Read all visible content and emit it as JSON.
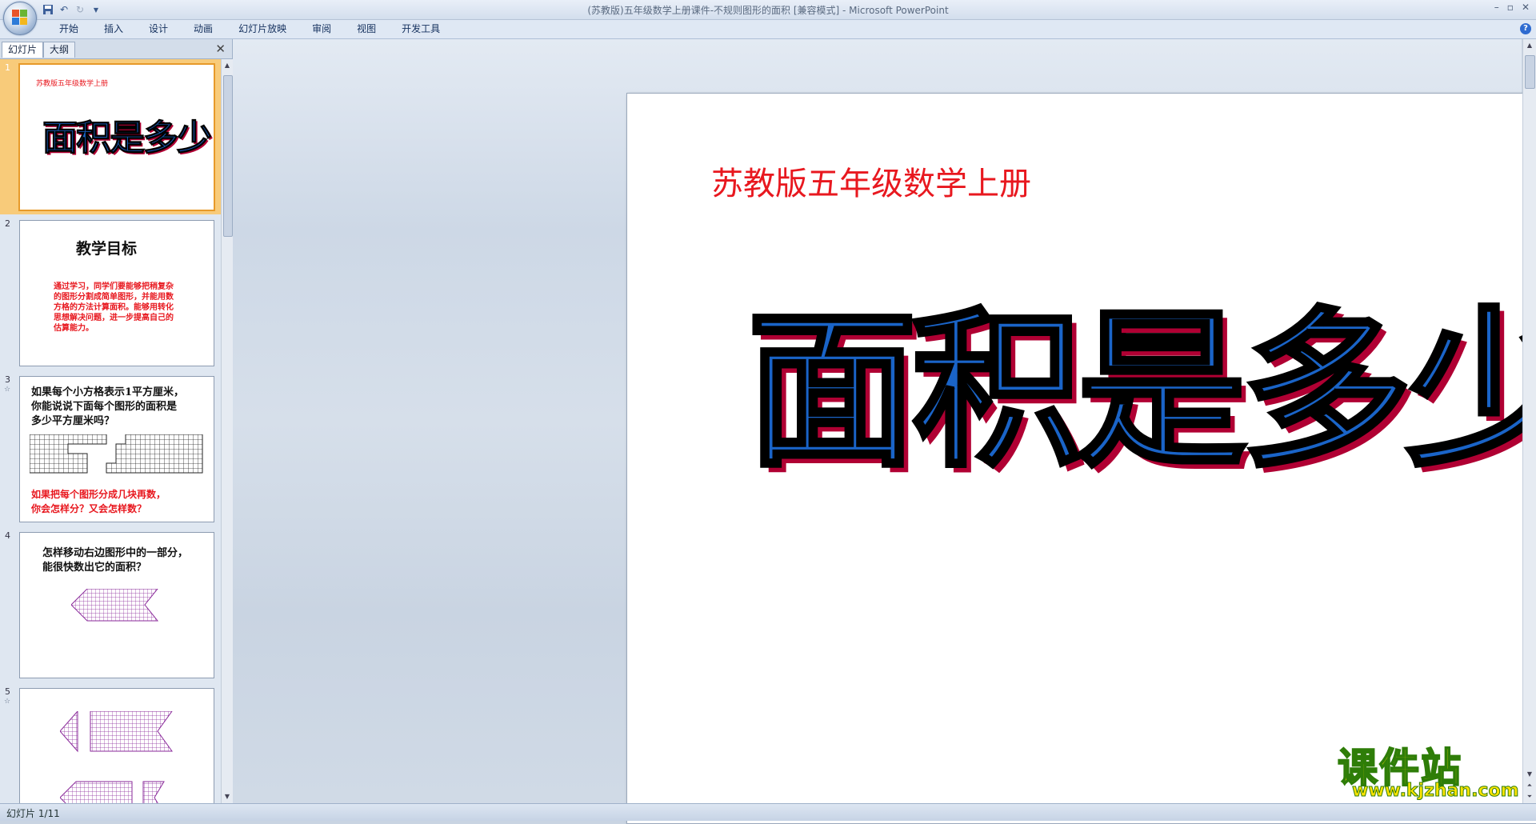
{
  "window": {
    "title": "(苏教版)五年级数学上册课件-不规则图形的面积 [兼容模式] - Microsoft PowerPoint",
    "controls": [
      "–",
      "▫",
      "✕"
    ]
  },
  "ribbon": {
    "tabs": [
      "开始",
      "插入",
      "设计",
      "动画",
      "幻灯片放映",
      "审阅",
      "视图",
      "开发工具"
    ]
  },
  "pane": {
    "tab_slides": "幻灯片",
    "tab_outline": "大纲",
    "close": "✕"
  },
  "thumbnails": [
    {
      "num": "1",
      "subtitle": "苏教版五年级数学上册",
      "title": "面积是多少"
    },
    {
      "num": "2",
      "heading": "教学目标",
      "lines": [
        "通过学习，同学们要能够把稍复杂",
        "的图形分割成简单图形，并能用数",
        "方格的方法计算面积。能够用转化",
        "思想解决问题，进一步提高自己的",
        "估算能力。"
      ]
    },
    {
      "num": "3",
      "star": "☆",
      "lines": [
        "如果每个小方格表示1平方厘米，",
        "你能说说下面每个图形的面积是",
        "多少平方厘米吗？"
      ],
      "red_lines": [
        "如果把每个图形分成几块再数，",
        "你会怎样分？又会怎样数？"
      ]
    },
    {
      "num": "4",
      "lines": [
        "怎样移动右边图形中的一部分，",
        "能很快数出它的面积？"
      ]
    },
    {
      "num": "5",
      "star": "☆"
    }
  ],
  "slide": {
    "subtitle": "苏教版五年级数学上册",
    "title": "面积是多少"
  },
  "watermark": {
    "title": "课件站",
    "url": "www.kjzhan.com"
  },
  "status": {
    "text": "幻灯片 1/11"
  },
  "colors": {
    "title_fill": "#1a64c8",
    "title_shadow": "#b00033",
    "subtitle": "#e8181f",
    "selected_thumb": "#f8cb7a"
  }
}
